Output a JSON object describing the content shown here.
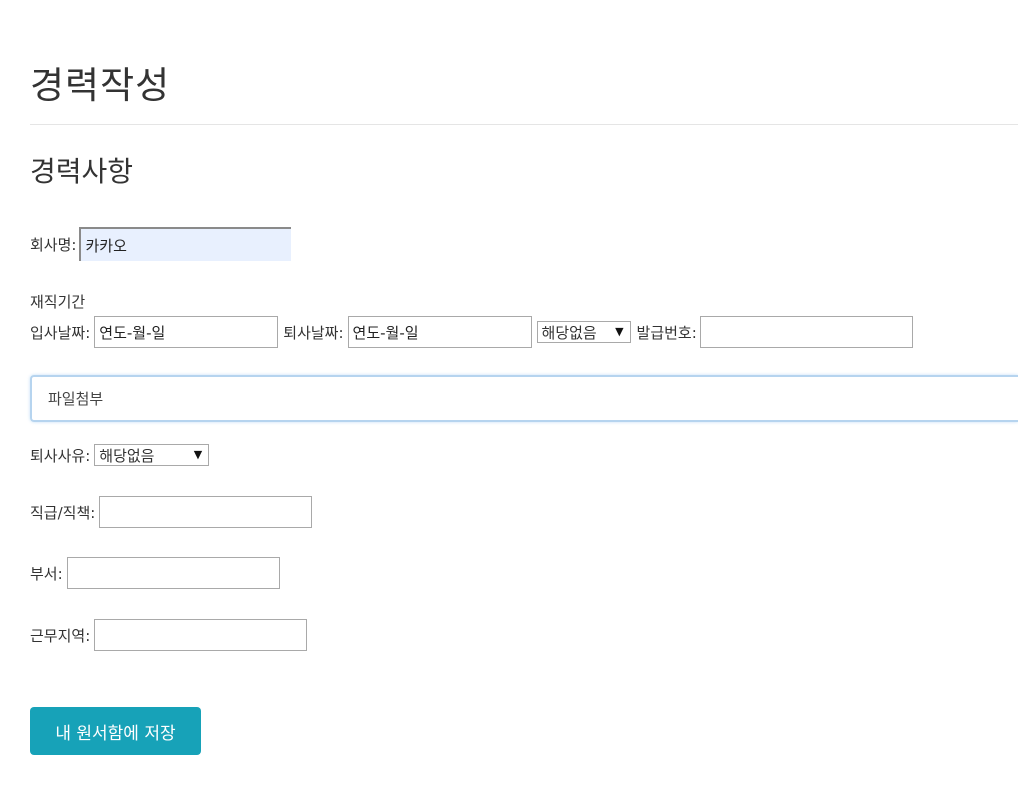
{
  "page": {
    "title": "경력작성",
    "section_title": "경력사항"
  },
  "form": {
    "company": {
      "label": "회사명:",
      "value": "카카오"
    },
    "tenure": {
      "heading": "재직기간",
      "join_label": "입사날짜:",
      "join_value": "연도-월-일",
      "leave_label": "퇴사날짜:",
      "leave_value": "연도-월-일",
      "status_select": "해당없음",
      "issue_label": "발급번호:",
      "issue_value": ""
    },
    "attachment": {
      "label": "파일첨부"
    },
    "reason": {
      "label": "퇴사사유:",
      "select": "해당없음"
    },
    "rank": {
      "label": "직급/직책:",
      "value": ""
    },
    "department": {
      "label": "부서:",
      "value": ""
    },
    "location": {
      "label": "근무지역:",
      "value": ""
    },
    "save_label": "내 원서함에 저장"
  }
}
